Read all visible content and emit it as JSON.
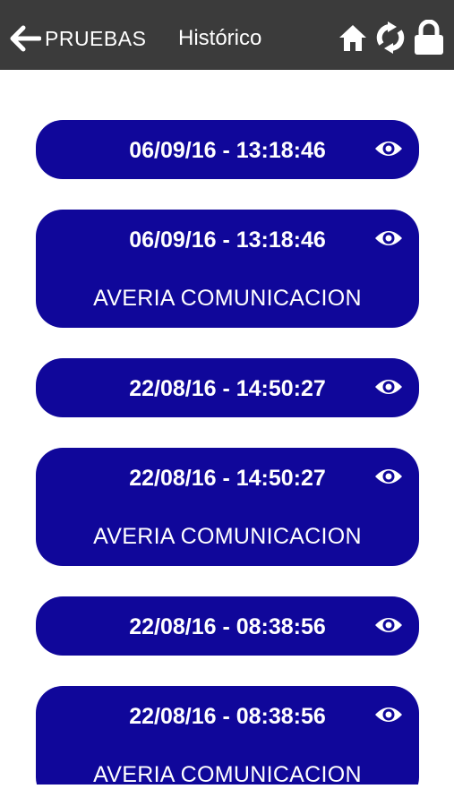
{
  "header": {
    "back_label": "PRUEBAS",
    "title": "Histórico",
    "icons": [
      "home-icon",
      "refresh-icon",
      "lock-icon"
    ]
  },
  "colors": {
    "header_bg": "#3b3b3b",
    "card_bg": "#10079a",
    "text": "#ffffff"
  },
  "events": [
    {
      "datetime": "06/09/16 - 13:18:46",
      "description": ""
    },
    {
      "datetime": "06/09/16 - 13:18:46",
      "description": "AVERIA COMUNICACION"
    },
    {
      "datetime": "22/08/16 - 14:50:27",
      "description": ""
    },
    {
      "datetime": "22/08/16 - 14:50:27",
      "description": "AVERIA COMUNICACION"
    },
    {
      "datetime": "22/08/16 - 08:38:56",
      "description": ""
    },
    {
      "datetime": "22/08/16 - 08:38:56",
      "description": "AVERIA COMUNICACION"
    }
  ]
}
